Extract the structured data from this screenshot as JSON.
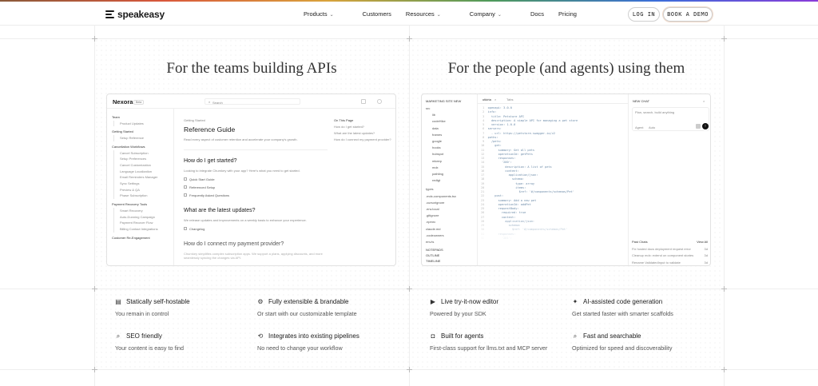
{
  "brand": {
    "name": "speakeasy"
  },
  "nav": {
    "items": [
      "Products",
      "Customers",
      "Resources",
      "Company",
      "Docs",
      "Pricing"
    ],
    "login": "LOG IN",
    "demo": "BOOK A DEMO"
  },
  "left": {
    "headline": "For the teams building APIs",
    "app_name": "Nexora",
    "app_badge": "Beta",
    "search": "Search",
    "sidebar": [
      "Team",
      "Product Updates",
      "Getting Started",
      "Setup Reference",
      "Cancellation Workflows",
      "Cancel Subscription",
      "Setup Preferences",
      "Cancel Customization",
      "Language Localization",
      "Email Reminders Manager",
      "Sync Settings",
      "Preview & QA",
      "Phase Subscription",
      "Payment Recovery Tools",
      "Smart Recovery",
      "Auto-Dunning Campaign",
      "Payment Recover Flow",
      "Billing Contact Integrations",
      "Customer Re-Engagement"
    ],
    "breadcrumb": "Getting Started",
    "page_title": "Reference Guide",
    "page_sub": "Read every aspect of customer retention and accelerate your company's growth.",
    "toc_title": "On This Page",
    "toc": [
      "How do I get started?",
      "What are the latest updates?",
      "How do I connect my payment provider?"
    ],
    "q1": "How do I get started?",
    "q1_text": "Looking to integrate Churnkey with your app? Here's what you need to get started.",
    "q1_items": [
      "Quick Start Guide",
      "Referenced Setup",
      "Frequently Asked Questions"
    ],
    "q2": "What are the latest updates?",
    "q2_text": "We release updates and improvements on a weekly basis to enhance your experience.",
    "q2_items": [
      "Changelog"
    ],
    "q3": "How do I connect my payment provider?",
    "q3_text": "Churnkey simplifies complex subscription apps. We support a plans, applying discounts, and more seamlessly syncing the changes via API."
  },
  "right": {
    "headline": "For the people (and agents) using them",
    "explorer_title": "MARKETING SITE NEW",
    "files": [
      "src",
      "lib",
      "codeHike",
      "data",
      "frames",
      "google",
      "hooks",
      "hubspot",
      "mkeep",
      "mdx",
      "pathling",
      "redtgt",
      "types",
      ".mdx-components.tsx",
      ".cursorignore",
      ".env.local",
      ".gitignore",
      ".npmrc",
      "claude.md",
      ".codeowners",
      "env.ts"
    ],
    "explorer_footer": [
      "NOTEPADS",
      "OUTLINE",
      "TIMELINE"
    ],
    "tabs": [
      "utkirta",
      "Tabs"
    ],
    "code": [
      "openapi: 3.0.0",
      "info:",
      "  title: Petstore API",
      "  description: A simple API for managing a pet store",
      "  version: 1.0.0",
      "servers:",
      "  - url: https://petstore.swagger.io/v2",
      "paths:",
      "  /pets:",
      "    get:",
      "      summary: Get all pets",
      "      operationId: getPets",
      "      responses:",
      "        '200':",
      "          description: A list of pets",
      "          content:",
      "            application/json:",
      "              schema:",
      "                type: array",
      "                items:",
      "                  $ref: '#/components/schemas/Pet'",
      "    post:",
      "      summary: Add a new pet",
      "      operationId: addPet",
      "      requestBody:",
      "        required: true",
      "        content:",
      "          application/json:",
      "            schema:",
      "              $ref: '#/components/schemas/Pet'",
      "      responses:",
      "        '201':"
    ],
    "chat_title": "NEW CHAT",
    "chat_placeholder": "Plan, search, build anything",
    "chat_controls": [
      "Agent",
      "Auto"
    ],
    "past_title": "Past Chats",
    "past_link": "View All",
    "past_chats": [
      [
        "Fix hosted docs deployment request error",
        "3d"
      ],
      [
        "Cleanup mdx: extend on component stories",
        "3d"
      ],
      [
        "Rename ValidatedInput to validate",
        "3d"
      ]
    ]
  },
  "features": [
    {
      "title": "Statically self-hostable",
      "desc": "You remain in control",
      "icon": "server-icon"
    },
    {
      "title": "Fully extensible & brandable",
      "desc": "Or start with our customizable template",
      "icon": "gear-icon"
    },
    {
      "title": "Live try-it-now editor",
      "desc": "Powered by your SDK",
      "icon": "play-icon"
    },
    {
      "title": "AI-assisted code generation",
      "desc": "Get started faster with smarter scaffolds",
      "icon": "sparkle-icon"
    },
    {
      "title": "SEO friendly",
      "desc": "Your content is easy to find",
      "icon": "search-icon"
    },
    {
      "title": "Integrates into existing pipelines",
      "desc": "No need to change your workflow",
      "icon": "pipeline-icon"
    },
    {
      "title": "Built for agents",
      "desc": "First-class support for llms.txt and MCP server",
      "icon": "bot-icon"
    },
    {
      "title": "Fast and searchable",
      "desc": "Optimized for speed and discoverability",
      "icon": "search-icon"
    }
  ]
}
